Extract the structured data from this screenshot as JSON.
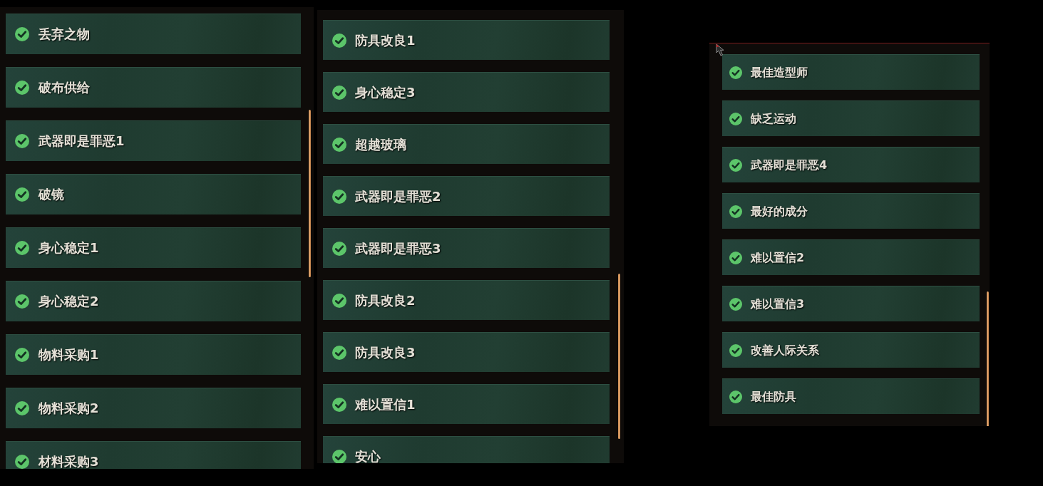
{
  "panels": [
    {
      "items": [
        {
          "label": "丢弃之物",
          "checked": true
        },
        {
          "label": "破布供给",
          "checked": true
        },
        {
          "label": "武器即是罪恶1",
          "checked": true
        },
        {
          "label": "破镜",
          "checked": true
        },
        {
          "label": "身心稳定1",
          "checked": true
        },
        {
          "label": "身心稳定2",
          "checked": true
        },
        {
          "label": "物料采购1",
          "checked": true
        },
        {
          "label": "物料采购2",
          "checked": true
        },
        {
          "label": "材料采购3",
          "checked": true
        }
      ]
    },
    {
      "items": [
        {
          "label": "防具改良1",
          "checked": true
        },
        {
          "label": "身心稳定3",
          "checked": true
        },
        {
          "label": "超越玻璃",
          "checked": true
        },
        {
          "label": "武器即是罪恶2",
          "checked": true
        },
        {
          "label": "武器即是罪恶3",
          "checked": true
        },
        {
          "label": "防具改良2",
          "checked": true
        },
        {
          "label": "防具改良3",
          "checked": true
        },
        {
          "label": "难以置信1",
          "checked": true
        },
        {
          "label": "安心",
          "checked": true
        }
      ]
    },
    {
      "items": [
        {
          "label": "最佳造型师",
          "checked": true
        },
        {
          "label": "缺乏运动",
          "checked": true
        },
        {
          "label": "武器即是罪恶4",
          "checked": true
        },
        {
          "label": "最好的成分",
          "checked": true
        },
        {
          "label": "难以置信2",
          "checked": true
        },
        {
          "label": "难以置信3",
          "checked": true
        },
        {
          "label": "改善人际关系",
          "checked": true
        },
        {
          "label": "最佳防具",
          "checked": true
        }
      ]
    }
  ]
}
